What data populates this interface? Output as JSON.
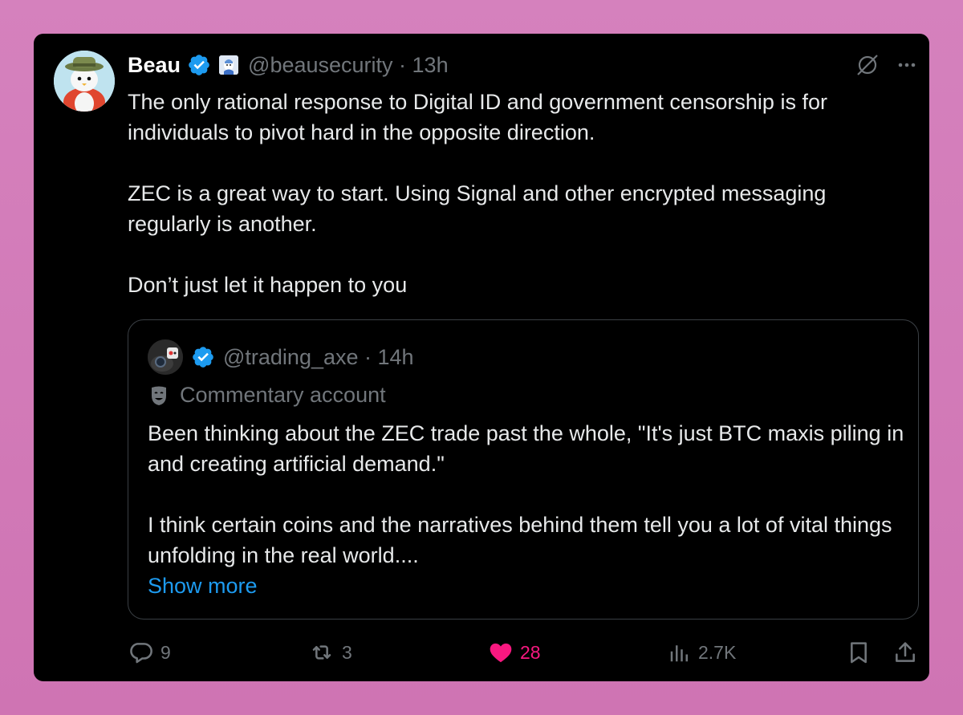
{
  "tweet": {
    "author_name": "Beau",
    "handle": "@beausecurity",
    "time": "13h",
    "paragraphs": [
      "The only rational response to Digital ID and government censorship is for individuals to pivot hard in the opposite direction.",
      "ZEC is a great way to start. Using Signal and other encrypted messaging regularly is another.",
      "Don’t just let it happen to you"
    ]
  },
  "quoted": {
    "handle": "@trading_axe",
    "time": "14h",
    "label": "Commentary account",
    "paragraphs": [
      "Been thinking about the ZEC trade past the whole, \"It's just BTC maxis piling in and creating artificial demand.\"",
      "I think certain coins and the narratives behind them tell you a lot of vital things unfolding in the real world...."
    ],
    "show_more": "Show more"
  },
  "actions": {
    "replies": "9",
    "reposts": "3",
    "likes": "28",
    "views": "2.7K"
  },
  "icons": {
    "reply": "reply-icon",
    "repost": "repost-icon",
    "like": "heart-icon",
    "views": "views-icon",
    "bookmark": "bookmark-icon",
    "share": "share-icon",
    "grok": "grok-icon",
    "more": "more-icon",
    "verified": "verified-badge-icon",
    "affiliate": "affiliate-badge-icon",
    "commentary": "theater-mask-icon"
  },
  "colors": {
    "background": "#000000",
    "text": "#e7e9ea",
    "secondary": "#71767b",
    "link": "#1d9bf0",
    "like": "#f91880",
    "verified": "#1d9bf0",
    "page_background": "#d581bd"
  }
}
